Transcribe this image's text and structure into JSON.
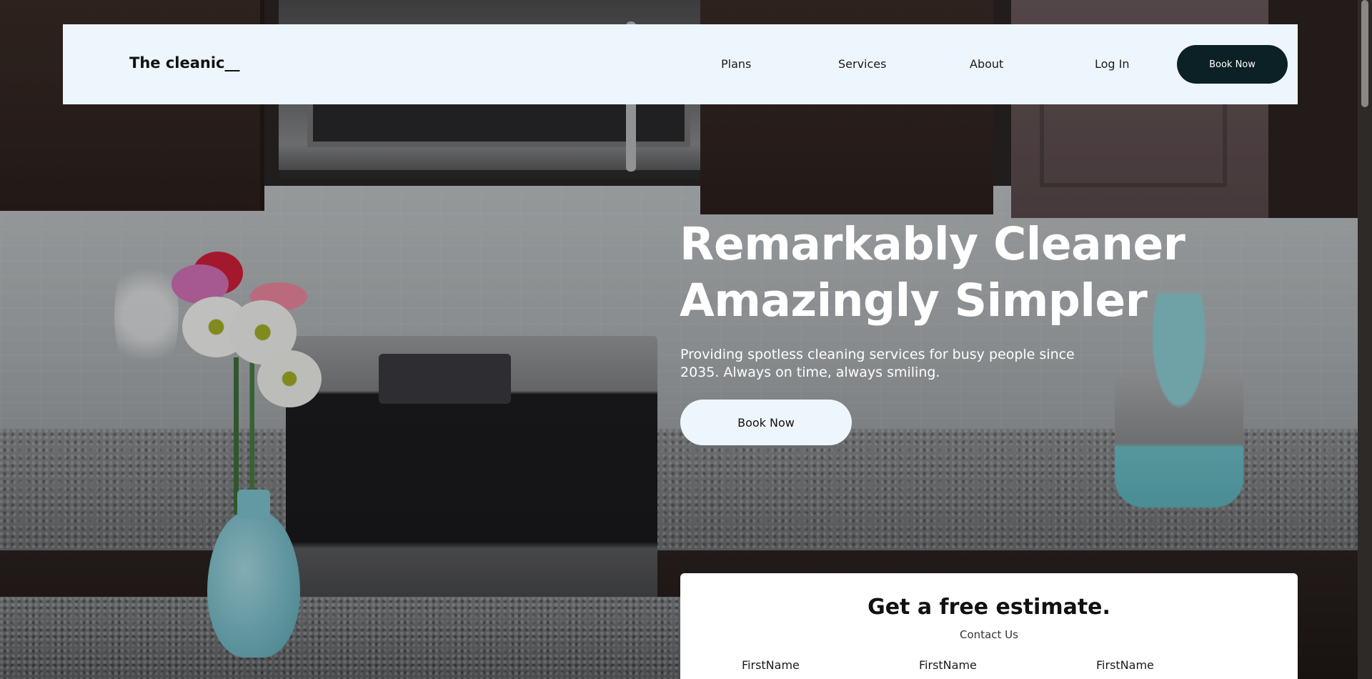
{
  "brand": {
    "logo_text": "The cleanic__"
  },
  "nav": {
    "items": [
      {
        "label": "Plans"
      },
      {
        "label": "Services"
      },
      {
        "label": "About"
      },
      {
        "label": "Log In"
      }
    ],
    "book_button": "Book Now"
  },
  "hero": {
    "title_line1": "Remarkably Cleaner",
    "title_line2": "Amazingly Simpler",
    "subtitle": "Providing spotless cleaning services for busy people since 2035. Always on time, always smiling.",
    "book_button": "Book Now"
  },
  "estimate": {
    "title": "Get a free estimate.",
    "subtitle": "Contact Us",
    "fields": [
      {
        "label": "FirstName"
      },
      {
        "label": "FirstName"
      },
      {
        "label": "FirstName"
      }
    ]
  },
  "colors": {
    "header_bg": "#eef6fd",
    "primary_button": "#0c2125",
    "hero_button_bg": "#eef6fd",
    "text_light": "#ffffff"
  }
}
